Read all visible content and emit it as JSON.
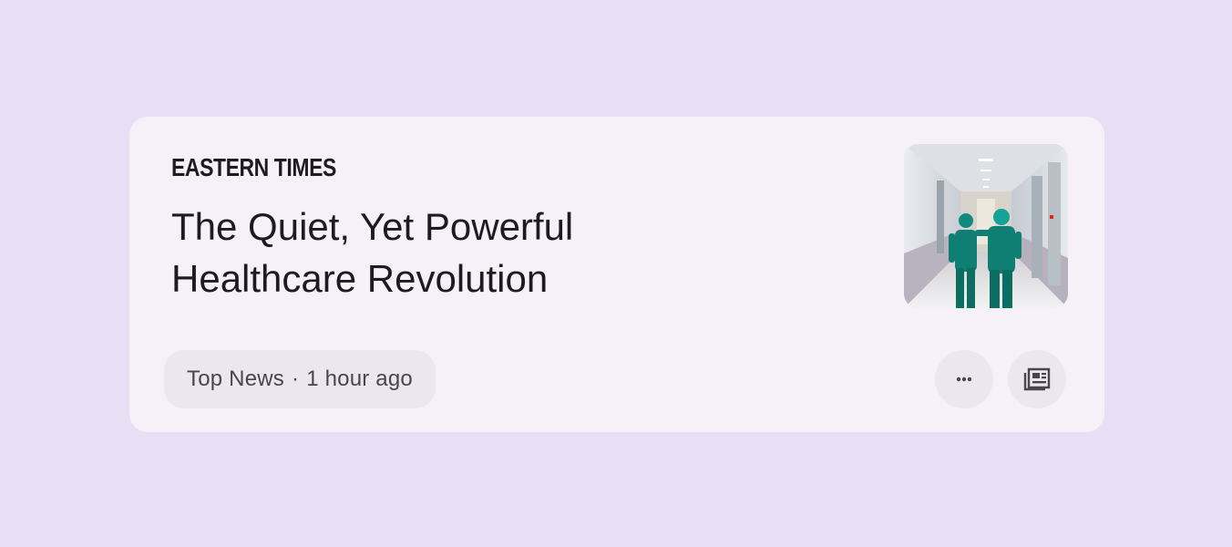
{
  "card": {
    "publisher": "EASTERN TIMES",
    "headline_line1": "The Quiet, Yet Powerful",
    "headline_line2": "Healthcare Revolution",
    "category": "Top News",
    "separator": "·",
    "time": "1 hour ago",
    "thumbnail_icon": "hospital-corridor-image"
  },
  "actions": {
    "more_icon": "more-horiz-icon",
    "news_icon": "newspaper-icon"
  },
  "colors": {
    "background": "#e8dff5",
    "card": "#f6f1f9",
    "chip": "#ece6f0",
    "text_primary": "#1d1b20",
    "text_secondary": "#49454f",
    "scrubs": "#0f7f73"
  }
}
